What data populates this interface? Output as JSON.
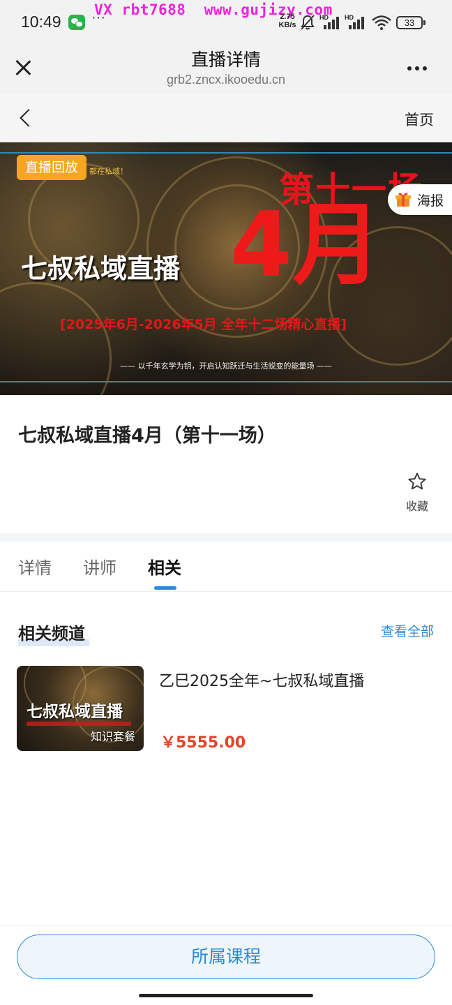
{
  "status_bar": {
    "time": "10:49",
    "more": "···",
    "watermark": "VX rbt7688  www.gujizy.com",
    "net_speed": "2.75",
    "net_unit": "KB/s",
    "signal_1": "HD",
    "signal_2": "HD",
    "battery": "33",
    "icons": [
      "wechat-icon",
      "bell-mute-icon",
      "signal-icon",
      "wifi-icon",
      "battery-icon"
    ]
  },
  "browser": {
    "title": "直播详情",
    "url": "grb2.zncx.ikooedu.cn"
  },
  "nav": {
    "home": "首页"
  },
  "banner": {
    "badge": "直播回放",
    "small_tag": "都在私域！",
    "round": "第十一场",
    "month": "4月",
    "title": "七叔私域直播",
    "dates": "[2025年6月-2026年5月  全年十二场精心直播]",
    "slogan": "—— 以千年玄学为钥，开启认知跃迁与生活蜕变的能量场 ——",
    "poster": "海报"
  },
  "live": {
    "title": "七叔私域直播4月（第十一场）",
    "favorite": "收藏"
  },
  "tabs": [
    {
      "label": "详情",
      "active": false
    },
    {
      "label": "讲师",
      "active": false
    },
    {
      "label": "相关",
      "active": true
    }
  ],
  "related": {
    "title": "相关频道",
    "view_all": "查看全部",
    "items": [
      {
        "thumb_title": "七叔私域直播",
        "thumb_tag": "知识套餐",
        "name": "乙巳2025全年~七叔私域直播",
        "price": "￥5555.00"
      }
    ]
  },
  "bottom": {
    "button": "所属课程"
  },
  "colors": {
    "accent": "#2b8ad8",
    "price": "#e5432b",
    "badge": "#f6a623",
    "banner_red": "#e8131b"
  }
}
